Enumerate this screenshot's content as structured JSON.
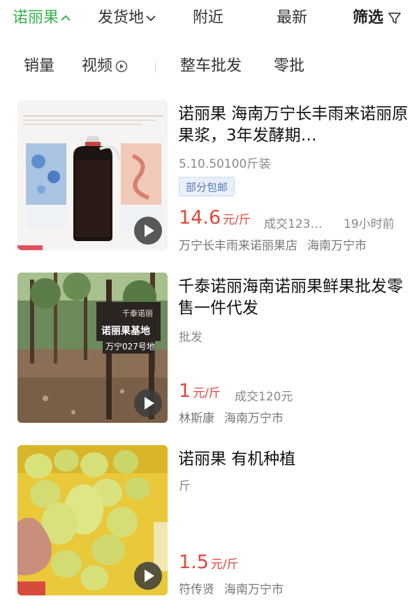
{
  "filter_bar": {
    "tabs": [
      {
        "label": "诺丽果"
      },
      {
        "label": "发货地"
      },
      {
        "label": "附近"
      },
      {
        "label": "最新"
      },
      {
        "label": "筛选"
      }
    ]
  },
  "sub_filters": {
    "items": [
      {
        "label": "销量"
      },
      {
        "label": "视频"
      },
      {
        "label": "整车批发"
      },
      {
        "label": "零批"
      }
    ]
  },
  "products": [
    {
      "title": "诺丽果  海南万宁长丰雨来诺丽原果浆，3年发酵期…",
      "spec": "5.10.50100斤装",
      "badge": "部分包邮",
      "price": "14.6",
      "unit": "元/斤",
      "deal": "成交123…",
      "time": "19小时前",
      "seller": "万宁长丰雨来诺丽果店",
      "location": "海南万宁市"
    },
    {
      "title": "千泰诺丽海南诺丽果鲜果批发零售一件代发",
      "spec": "批发",
      "price": "1",
      "unit": "元/斤",
      "deal": "成交120元",
      "seller": "林斯康",
      "location": "海南万宁市",
      "sign_brand": "千泰诺丽",
      "sign_main": "诺丽果基地",
      "sign_sub": "万宁027号地"
    },
    {
      "title": "诺丽果  有机种植",
      "spec": "斤",
      "price": "1.5",
      "unit": "元/斤",
      "seller": "符传贤",
      "location": "海南万宁市"
    }
  ],
  "colors": {
    "accent": "#34b44a",
    "price": "#e0463b",
    "badge_text": "#5a7ab8"
  }
}
